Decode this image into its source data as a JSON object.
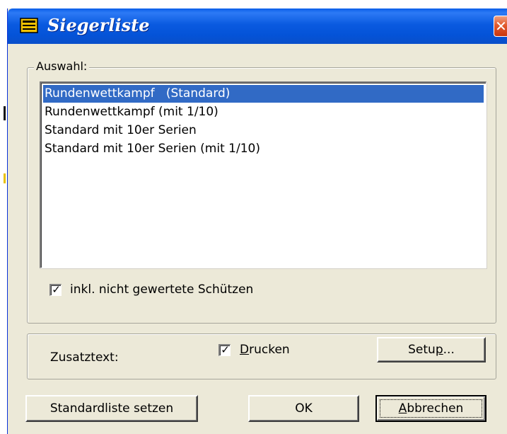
{
  "window": {
    "title": "Siegerliste",
    "app_icon": "window-app-icon",
    "close_icon": "close-icon"
  },
  "auswahl": {
    "legend": "Auswahl:",
    "items": [
      {
        "label": "Rundenwettkampf   (Standard)",
        "selected": true
      },
      {
        "label": "Rundenwettkampf (mit 1/10)",
        "selected": false
      },
      {
        "label": "Standard mit 10er Serien",
        "selected": false
      },
      {
        "label": "Standard mit 10er Serien (mit 1/10)",
        "selected": false
      }
    ],
    "include_unranked": {
      "label": "inkl. nicht gewertete Schützen",
      "checked": true
    }
  },
  "zusatztext": {
    "label": "Zusatztext:",
    "print_checkbox": {
      "label_underlined": "D",
      "label_rest": "rucken",
      "checked": true
    },
    "setup_button": {
      "label_before": "Setu",
      "label_underlined": "p",
      "label_after": "..."
    }
  },
  "buttons": {
    "standard_list": "Standardliste setzen",
    "ok": "OK",
    "cancel_underlined": "A",
    "cancel_rest": "bbrechen"
  },
  "colors": {
    "titlebar": "#0a5ae0",
    "selection": "#316ac5",
    "dialog_bg": "#ece9d8"
  }
}
